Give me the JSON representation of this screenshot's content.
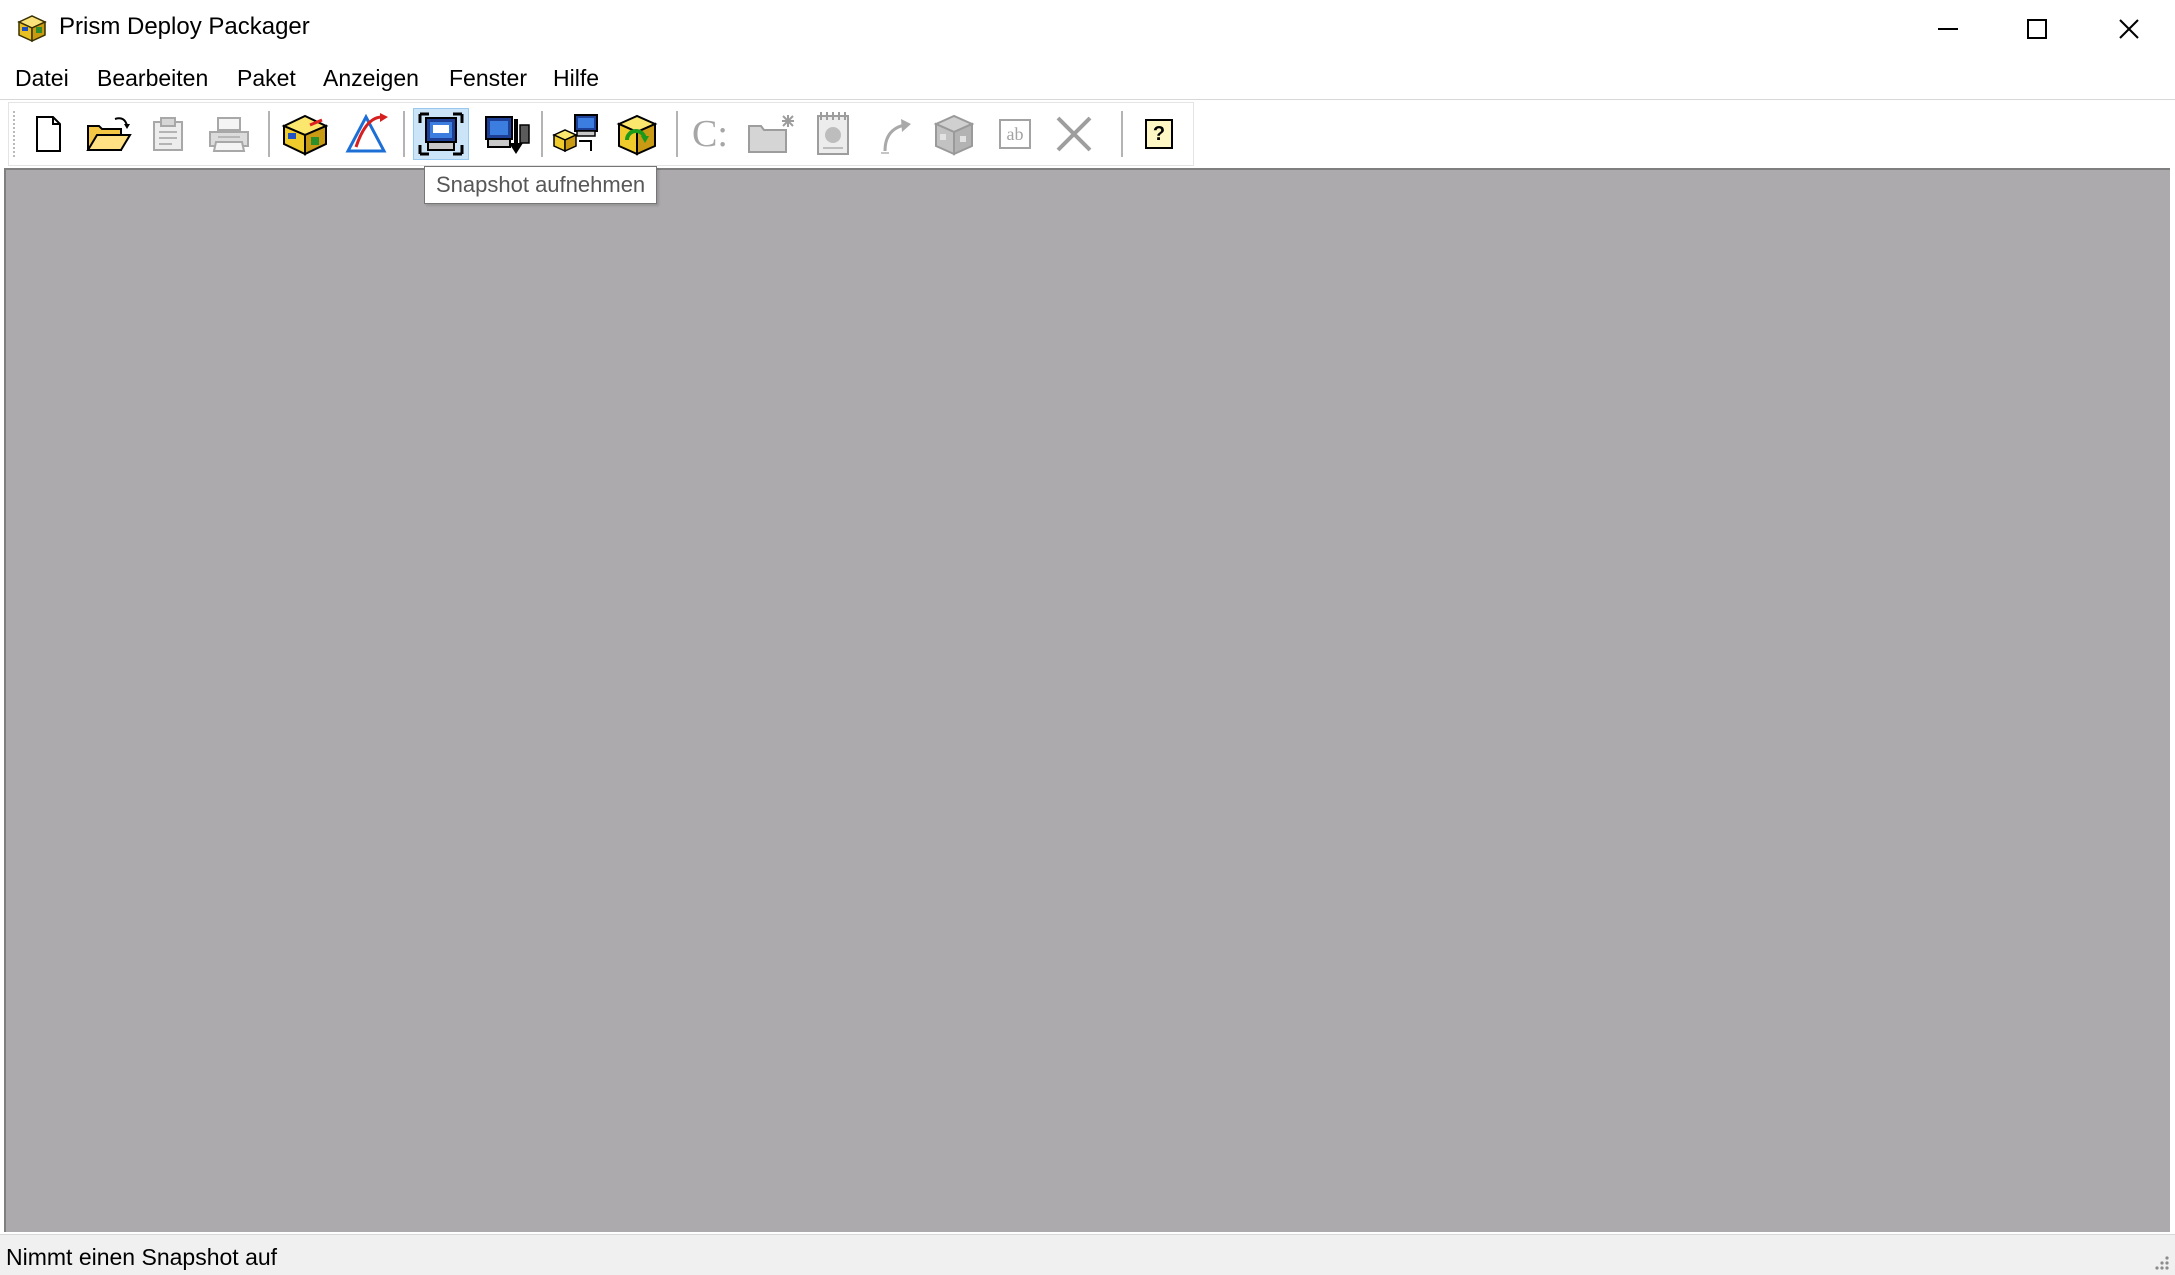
{
  "window": {
    "title": "Prism Deploy Packager",
    "app_icon": "package-box-icon",
    "controls": [
      "minimize-icon",
      "maximize-icon",
      "close-icon"
    ]
  },
  "menu": {
    "items": [
      "Datei",
      "Bearbeiten",
      "Paket",
      "Anzeigen",
      "Fenster",
      "Hilfe"
    ]
  },
  "toolbar": {
    "buttons": [
      {
        "icon": "new-document-icon",
        "enabled": true
      },
      {
        "icon": "open-folder-icon",
        "enabled": true
      },
      {
        "icon": "properties-icon",
        "enabled": false
      },
      {
        "icon": "print-icon",
        "enabled": false
      },
      {
        "icon": "package-icon",
        "enabled": true
      },
      {
        "icon": "delta-icon",
        "enabled": true
      },
      {
        "icon": "snapshot-icon",
        "enabled": true,
        "pressed": true
      },
      {
        "icon": "compare-snapshot-icon",
        "enabled": true
      },
      {
        "icon": "deploy-icon",
        "enabled": true
      },
      {
        "icon": "recycle-package-icon",
        "enabled": true
      },
      {
        "icon": "drive-c-icon",
        "enabled": false
      },
      {
        "icon": "new-folder-icon",
        "enabled": false
      },
      {
        "icon": "registry-icon",
        "enabled": false
      },
      {
        "icon": "shortcut-icon",
        "enabled": false
      },
      {
        "icon": "components-icon",
        "enabled": false
      },
      {
        "icon": "rename-icon",
        "enabled": false
      },
      {
        "icon": "delete-icon",
        "enabled": false
      },
      {
        "icon": "help-icon",
        "enabled": true
      }
    ],
    "drive_label": "C:",
    "rename_label": "ab",
    "help_label": "?"
  },
  "tooltip": {
    "text": "Snapshot aufnehmen"
  },
  "status": {
    "text": "Nimmt einen Snapshot auf"
  },
  "colors": {
    "workspace": "#acaaac",
    "pressed_button": "#cce4f7",
    "package_yellow": "#f5d33b"
  }
}
